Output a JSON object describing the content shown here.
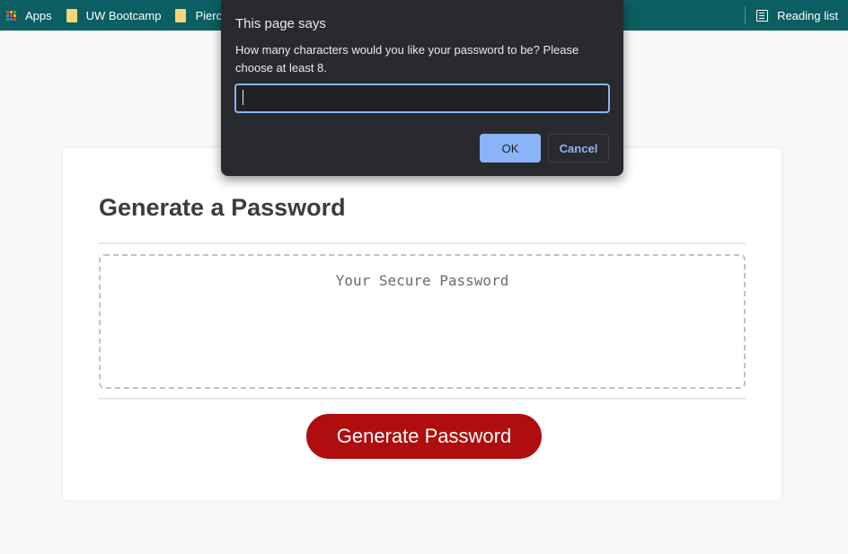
{
  "bookmarks": {
    "apps_label": "Apps",
    "apps_icon": "apps-grid-icon",
    "apps_colors": [
      "#ea4335",
      "#fbbc04",
      "#34a853",
      "#4285f4",
      "#ea4335",
      "#fbbc04",
      "#34a853",
      "#4285f4",
      "#ea4335"
    ],
    "items": [
      {
        "label": "UW Bootcamp",
        "icon": "folder-icon"
      },
      {
        "label": "Pierce",
        "icon": "folder-icon"
      }
    ],
    "reading_list_label": "Reading list",
    "reading_list_icon": "reading-list-icon",
    "bar_color": "#0b5e62"
  },
  "card": {
    "title": "Generate a Password",
    "password_placeholder": "Your Secure Password",
    "generate_button_label": "Generate Password",
    "button_color": "#b00d0e"
  },
  "dialog": {
    "title": "This page says",
    "message": "How many characters would you like your password to be? Please choose at least 8.",
    "input_value": "",
    "ok_label": "OK",
    "cancel_label": "Cancel",
    "accent_color": "#8ab4f8"
  }
}
